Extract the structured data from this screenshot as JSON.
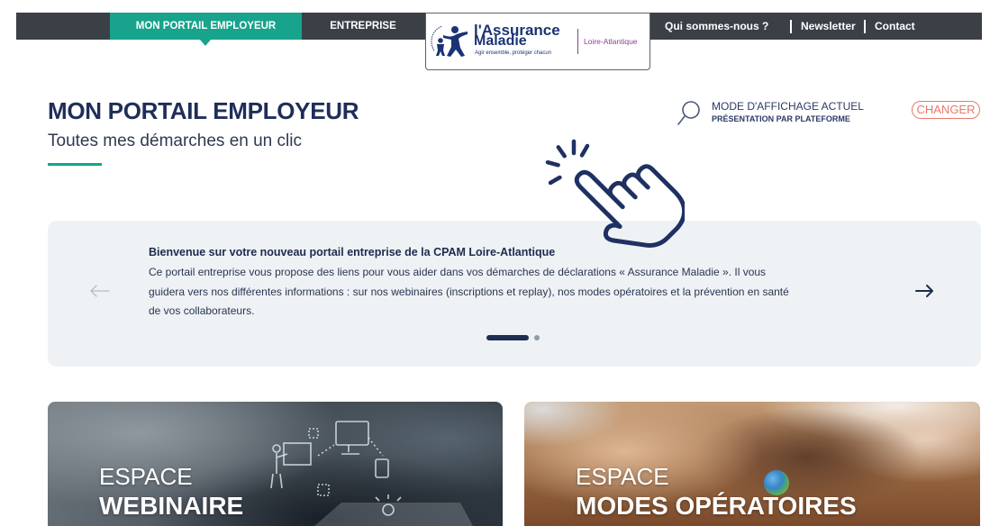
{
  "topnav": {
    "tabs": [
      {
        "label": "MON PORTAIL EMPLOYEUR",
        "active": true
      },
      {
        "label": "ENTREPRISE",
        "active": false
      }
    ],
    "logo": {
      "icon": "assurance-maladie-emblem",
      "line1": "l'Assurance",
      "line2": "Maladie",
      "tagline": "Agir ensemble, protéger chacun",
      "region": "Loire-Atlantique"
    },
    "links": [
      {
        "label": "Qui sommes-nous ?"
      },
      {
        "label": "Newsletter"
      },
      {
        "label": "Contact"
      }
    ]
  },
  "header": {
    "title_regular": "MON PORTAIL",
    "title_bold": "EMPLOYEUR",
    "subtitle": "Toutes mes démarches en un clic"
  },
  "display_mode": {
    "icon": "search-icon",
    "label": "MODE D'AFFICHAGE ACTUEL",
    "value": "PRÉSENTATION PAR PLATEFORME",
    "change_button": "CHANGER"
  },
  "overlay": {
    "icon": "click-hand-icon"
  },
  "carousel": {
    "title": "Bienvenue sur votre nouveau portail entreprise de la CPAM Loire-Atlantique",
    "body_lines": [
      "Ce portail entreprise vous propose des liens pour vous aider dans vos démarches de déclarations « Assurance Maladie ». Il vous",
      "guidera vers nos différentes informations : sur nos webinaires (inscriptions et replay), nos modes opératoires et la prévention en santé",
      "de vos collaborateurs."
    ],
    "prev_icon": "arrow-left-icon",
    "next_icon": "arrow-right-icon",
    "slide_count": 2,
    "active_slide": 1
  },
  "cards": [
    {
      "kicker": "ESPACE",
      "title": "WEBINAIRE"
    },
    {
      "kicker": "ESPACE",
      "title": "MODES OPÉRATOIRES"
    }
  ],
  "colors": {
    "teal": "#17a38c",
    "navy": "#1f2d5a",
    "topbar": "#3b4046",
    "coral": "#e5796d",
    "logo_purple": "#8b3f96",
    "logo_blue": "#1b3374",
    "panel": "#eef2f5"
  }
}
